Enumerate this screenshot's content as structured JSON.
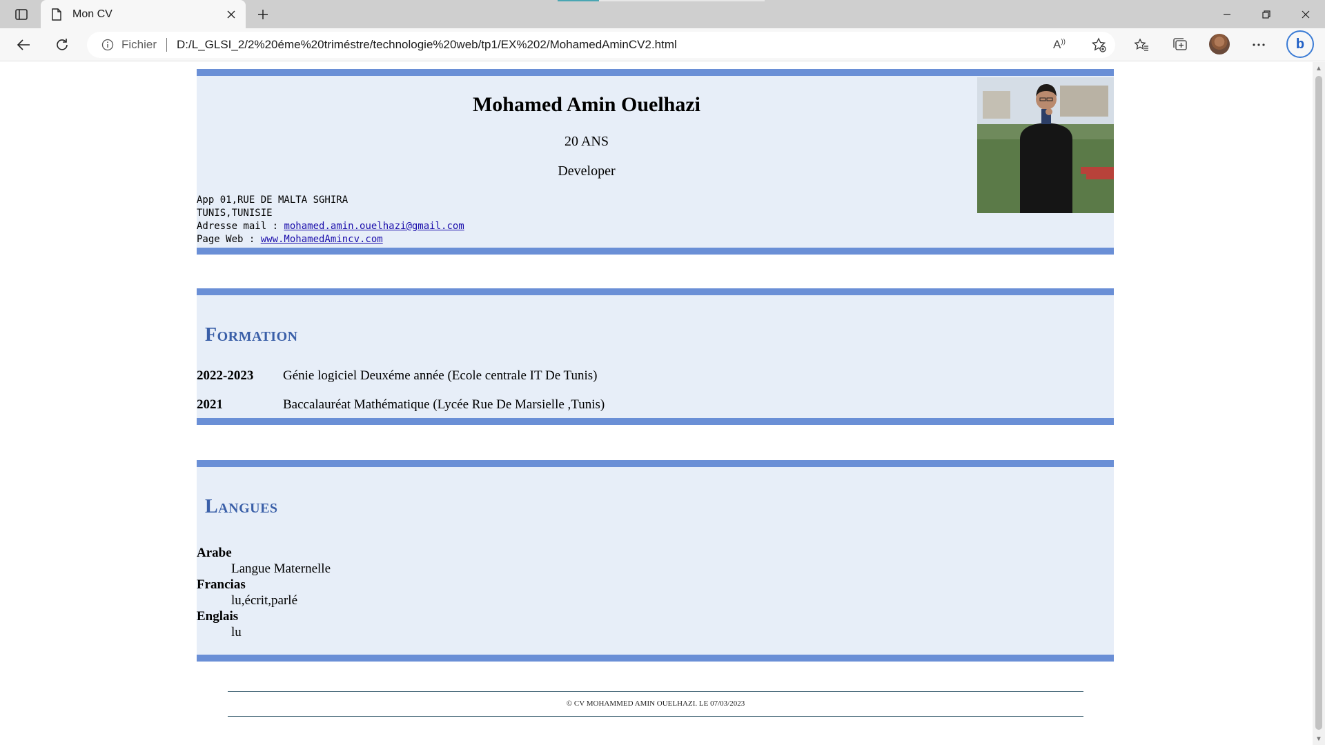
{
  "browser": {
    "tab_title": "Mon CV",
    "scheme_label": "Fichier",
    "url": "D:/L_GLSI_2/2%20éme%20triméstre/technologie%20web/tp1/EX%202/MohamedAminCV2.html"
  },
  "cv": {
    "name": "Mohamed Amin Ouelhazi",
    "age": "20 ANS",
    "role": "Developer",
    "address_line1": "App 01,RUE DE MALTA SGHIRA",
    "address_line2": "TUNIS,TUNISIE",
    "email_label": "Adresse mail : ",
    "email": "mohamed.amin.ouelhazi@gmail.com",
    "web_label": "Page Web : ",
    "web": "www.MohamedAmincv.com"
  },
  "formation": {
    "title": "Formation",
    "items": [
      {
        "year": "2022-2023",
        "text": "Génie logiciel Deuxéme année (Ecole centrale IT De Tunis)"
      },
      {
        "year": "2021",
        "text": "Baccalauréat Mathématique (Lycée Rue De Marsielle ,Tunis)"
      }
    ]
  },
  "langues": {
    "title": "Langues",
    "items": [
      {
        "lang": "Arabe",
        "level": "Langue Maternelle"
      },
      {
        "lang": "Francias",
        "level": "lu,écrit,parlé"
      },
      {
        "lang": "Englais",
        "level": "lu"
      }
    ]
  },
  "footer": {
    "text": "© CV MOHAMMED AMIN OUELHAZI. LE 07/03/2023"
  },
  "colors": {
    "section_border": "#6a8fd6",
    "section_bg": "#e7eef8",
    "heading": "#3a5fa8"
  }
}
